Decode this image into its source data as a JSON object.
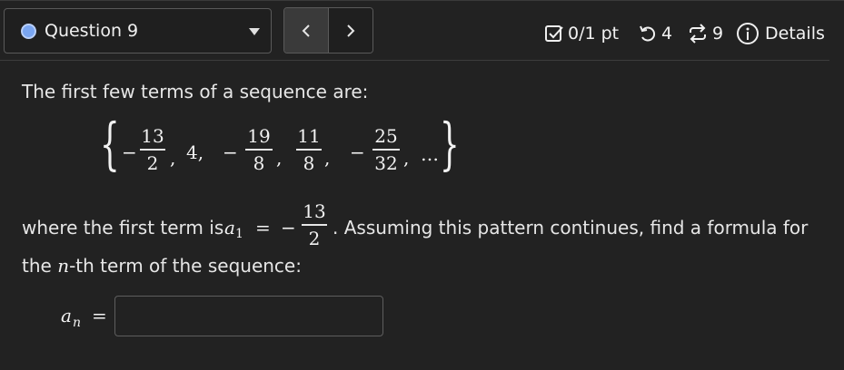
{
  "header": {
    "question_label": "Question 9",
    "score": "0/1 pt",
    "retries": "4",
    "versions": "9",
    "details_label": "Details",
    "status_color": "#7aa6f2"
  },
  "question": {
    "prompt": "The first few terms of a sequence are:",
    "sequence": {
      "open_brace": "{",
      "close_brace": "}",
      "t1": {
        "sign": "−",
        "num": "13",
        "den": "2"
      },
      "t2": "4,",
      "t3": {
        "sign": "−",
        "num": "19",
        "den": "8"
      },
      "t4": {
        "num": "11",
        "den": "8"
      },
      "t5": {
        "sign": "−",
        "num": "25",
        "den": "32"
      },
      "comma": ",",
      "ellipsis": "…"
    },
    "first_term_text": "where the first term is",
    "first_term_var": "a",
    "first_term_sub": "1",
    "equals": "=",
    "first_term_value": {
      "sign": "−",
      "num": "13",
      "den": "2"
    },
    "instruction_tail": ". Assuming this pattern continues, find a formula for",
    "line3_pre": "the",
    "line3_var": "n",
    "line3_post": "-th term of the sequence:",
    "answer_var": "a",
    "answer_sub": "n",
    "answer_value": ""
  }
}
